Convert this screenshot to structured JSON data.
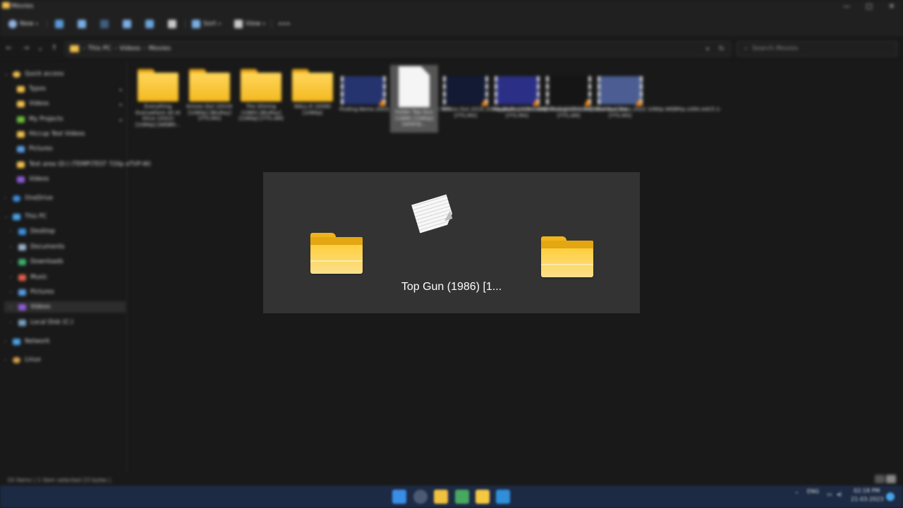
{
  "window": {
    "title": "Movies",
    "controls": [
      "—",
      "□",
      "✕"
    ]
  },
  "toolbar": {
    "new_label": "New",
    "sort_label": "Sort",
    "view_label": "View",
    "more_label": "•••"
  },
  "address": {
    "crumbs": [
      "This PC",
      "Videos",
      "Movies"
    ],
    "search_placeholder": "Search Movies"
  },
  "sidebar": {
    "quick_access": "Quick access",
    "items": [
      "Typos",
      "Videos",
      "My Projects",
      "Hiccup Test Videos",
      "Pictures",
      "Test area (D:) (TEMP\\TEST 720p eTVP-W)",
      "Videos"
    ],
    "onedrive": "OneDrive",
    "this_pc": "This PC",
    "pc_items": [
      "Desktop",
      "Documents",
      "Downloads",
      "Music",
      "Pictures",
      "Videos",
      "Local Disk (C:)"
    ],
    "network": "Network",
    "linux": "Linux"
  },
  "files": [
    {
      "name": "Everything Everywhere All At Once (2022) [1080p] [WEBRi...",
      "type": "folder"
    },
    {
      "name": "Knives Out (2019) [1080p] [BluRay] [YTS.MX]",
      "type": "folder"
    },
    {
      "name": "The Shining (1980) [BluRay] [1080p] [YTS.AM]",
      "type": "folder"
    },
    {
      "name": "WALL-E (2008) [1080p]",
      "type": "folder"
    },
    {
      "name": "Finding.Nemo.2003.1080p.BluRay.x264.YIFY",
      "type": "video",
      "color": "#25336e"
    },
    {
      "name": "Folder Top Gun (1986) [1080p] [webrip...",
      "type": "doc",
      "selected": true
    },
    {
      "name": "Knives.Out.2019.1080p.BluRay.x264.AAC-[YTS.MX]",
      "type": "video",
      "color": "#131a33"
    },
    {
      "name": "Magnolia.1999.1080p.BluRay.x264.AAC5.1-[YTS.MX]",
      "type": "video",
      "color": "#2b2f86"
    },
    {
      "name": "Oldboy.2003.1080p.BluRay.x264-[YTS.AM]",
      "type": "video",
      "color": "#151515"
    },
    {
      "name": "The.Bad.Guys.2022.1080p.WEBRip.x264.AAC5.1-[YTS.MX]",
      "type": "video",
      "color": "#4b5d92"
    }
  ],
  "status": {
    "text": "10 items  |  1 item selected  23 bytes  |"
  },
  "taskbar": {
    "tray_lang": "ENG",
    "tray_time": "02:18 PM",
    "tray_date": "21-03-2023"
  },
  "dialog": {
    "filename": "Top Gun (1986) [1..."
  }
}
